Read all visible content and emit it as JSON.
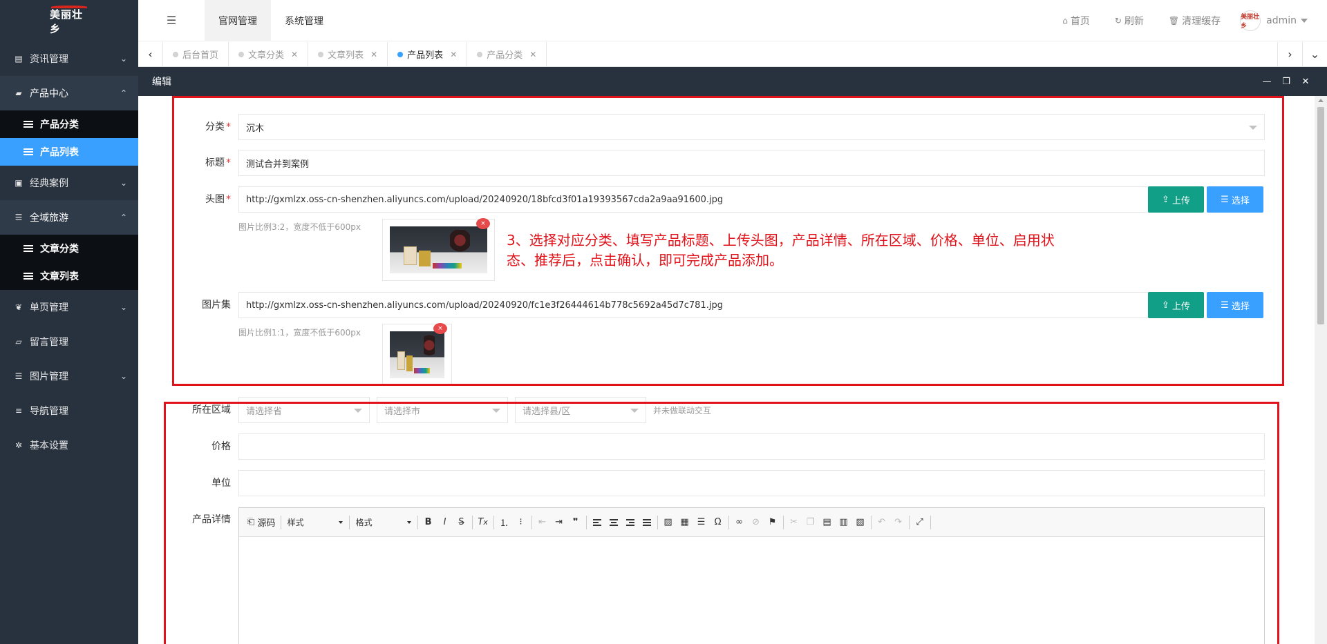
{
  "app": {
    "logo_text": "美丽壮乡"
  },
  "sidebar": {
    "items": [
      {
        "label": "资讯管理",
        "icon": "document-icon",
        "arrow": "⌄",
        "open": false,
        "children": []
      },
      {
        "label": "产品中心",
        "icon": "bag-icon",
        "arrow": "⌃",
        "open": true,
        "children": [
          {
            "label": "产品分类",
            "active": false
          },
          {
            "label": "产品列表",
            "active": true
          }
        ]
      },
      {
        "label": "经典案例",
        "icon": "briefcase-icon",
        "arrow": "⌄",
        "open": false,
        "children": []
      },
      {
        "label": "全域旅游",
        "icon": "list-icon",
        "arrow": "⌃",
        "open": true,
        "children": [
          {
            "label": "文章分类",
            "active": false
          },
          {
            "label": "文章列表",
            "active": false
          }
        ]
      },
      {
        "label": "单页管理",
        "icon": "leaf-icon",
        "arrow": "⌄",
        "open": false,
        "children": []
      },
      {
        "label": "留言管理",
        "icon": "book-icon",
        "arrow": "",
        "open": false,
        "children": []
      },
      {
        "label": "图片管理",
        "icon": "list-icon",
        "arrow": "⌄",
        "open": false,
        "children": []
      },
      {
        "label": "导航管理",
        "icon": "menu-icon",
        "arrow": "",
        "open": false,
        "children": []
      },
      {
        "label": "基本设置",
        "icon": "gear-icon",
        "arrow": "",
        "open": false,
        "children": []
      }
    ]
  },
  "header": {
    "tabs": [
      {
        "label": "官网管理",
        "active": true
      },
      {
        "label": "系统管理",
        "active": false
      }
    ],
    "home": "首页",
    "refresh": "刷新",
    "clear_cache": "清理缓存",
    "avatar_text": "美丽壮乡",
    "user": "admin"
  },
  "page_tabs": [
    {
      "label": "后台首页",
      "active": false,
      "closable": false
    },
    {
      "label": "文章分类",
      "active": false,
      "closable": true
    },
    {
      "label": "文章列表",
      "active": false,
      "closable": true
    },
    {
      "label": "产品列表",
      "active": true,
      "closable": true
    },
    {
      "label": "产品分类",
      "active": false,
      "closable": true
    }
  ],
  "modal": {
    "title": "编辑",
    "minimize": "—",
    "maximize": "❐",
    "close": "✕"
  },
  "form": {
    "category": {
      "label": "分类",
      "value": "沉木"
    },
    "title": {
      "label": "标题",
      "value": "测试合并到案例"
    },
    "cover": {
      "label": "头图",
      "value": "http://gxmlzx.oss-cn-shenzhen.aliyuncs.com/upload/20240920/18bfcd3f01a19393567cda2a9aa91600.jpg",
      "hint": "图片比例3:2，宽度不低于600px"
    },
    "gallery": {
      "label": "图片集",
      "value": "http://gxmlzx.oss-cn-shenzhen.aliyuncs.com/upload/20240920/fc1e3f26444614b778c5692a45d7c781.jpg",
      "hint": "图片比例1:1，宽度不低于600px"
    },
    "upload_label": "上传",
    "choose_label": "选择",
    "delete_glyph": "×",
    "region": {
      "label": "所在区域",
      "province_placeholder": "请选择省",
      "city_placeholder": "请选择市",
      "county_placeholder": "请选择县/区",
      "note": "并未做联动交互"
    },
    "price": {
      "label": "价格",
      "value": ""
    },
    "unit": {
      "label": "单位",
      "value": ""
    },
    "detail": {
      "label": "产品详情"
    }
  },
  "editor": {
    "source": "源码",
    "style_combo": "样式",
    "format_combo": "格式"
  },
  "annotation": {
    "line1": "3、选择对应分类、填写产品标题、上传头图，产品详情、所在区域、价格、单位、启用状",
    "line2": "态、推荐后，点击确认，即可完成产品添加。"
  },
  "colors": {
    "sidebar_bg": "#28323f",
    "accent_blue": "#3aa0ff",
    "upload_green": "#129f87",
    "annotation_red": "#e0121a"
  }
}
